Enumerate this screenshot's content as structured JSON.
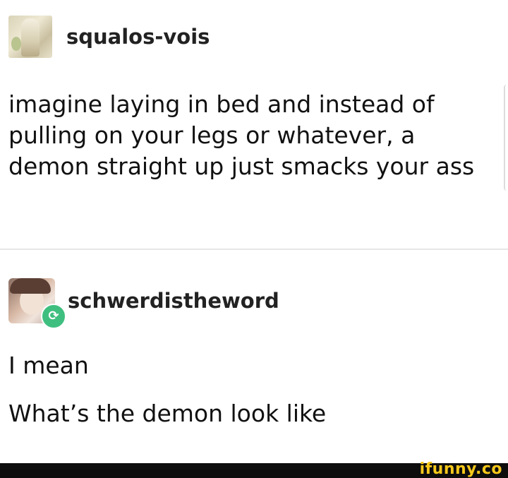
{
  "posts": [
    {
      "username": "squalos-vois",
      "text": "imagine laying in bed and instead of pulling on your legs or whatever, a demon straight up just smacks your ass"
    },
    {
      "username": "schwerdistheword",
      "reblog_icon": "reblog-icon",
      "paragraphs": [
        "I mean",
        "What’s the demon look like"
      ]
    }
  ],
  "watermark": "ifunny.co",
  "colors": {
    "reblog_badge": "#3fbf7f",
    "watermark": "#f6c81a",
    "footer_bar": "#0d0d0d"
  }
}
